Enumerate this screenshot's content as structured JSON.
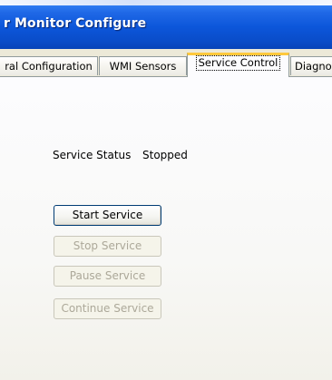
{
  "window": {
    "title": "r Monitor Configure"
  },
  "tabs": [
    {
      "label": "ral Configuration",
      "active": false
    },
    {
      "label": "WMI Sensors",
      "active": false
    },
    {
      "label": "Service Control",
      "active": true
    },
    {
      "label": "Diagno",
      "active": false
    }
  ],
  "service": {
    "status_label": "Service Status",
    "status_value": "Stopped"
  },
  "buttons": {
    "start": {
      "label": "Start Service",
      "enabled": true
    },
    "stop": {
      "label": "Stop Service",
      "enabled": false
    },
    "pause": {
      "label": "Pause Service",
      "enabled": false
    },
    "continue": {
      "label": "Continue Service",
      "enabled": false
    }
  },
  "colors": {
    "titlebar": "#0a52d8",
    "active_tab_highlight": "#ffc83c",
    "disabled_text": "#aca899"
  }
}
